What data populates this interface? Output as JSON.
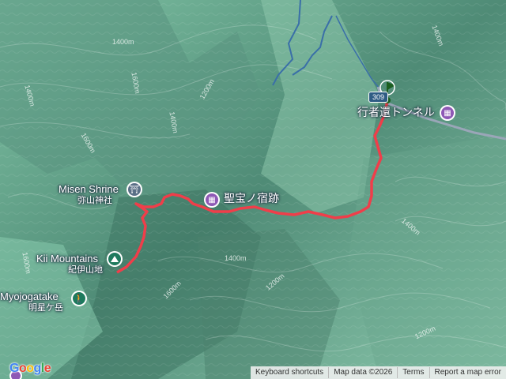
{
  "map": {
    "places": {
      "misen_shrine": {
        "name": "Misen Shrine",
        "local": "弥山神社"
      },
      "kii_mountains": {
        "name": "Kii Mountains",
        "local": "紀伊山地"
      },
      "myojogatake": {
        "name": "Myojogatake",
        "local": "明星ケ岳"
      },
      "seihou_site": {
        "name": "聖宝ノ宿跡"
      },
      "gyoja_tunnel": {
        "name": "行者還トンネル"
      }
    },
    "road_shield": "309",
    "contours": [
      "1400m",
      "1400m",
      "1400m",
      "1200m",
      "1600m",
      "1600m",
      "1600m",
      "1400m",
      "1400m",
      "1400m",
      "1200m",
      "1600m",
      "1200m"
    ],
    "track_color": "#ef3e4a",
    "route_direction_color": "#1a73e8"
  },
  "attribution": {
    "logo": "Google",
    "keyboard_shortcuts": "Keyboard shortcuts",
    "map_data": "Map data ©2026",
    "terms": "Terms",
    "report": "Report a map error"
  },
  "icons": {
    "shrine": "torii-icon",
    "landmark": "building-icon",
    "peak": "mountain-icon",
    "hiker": "hiker-icon",
    "start": "flag-icon"
  }
}
